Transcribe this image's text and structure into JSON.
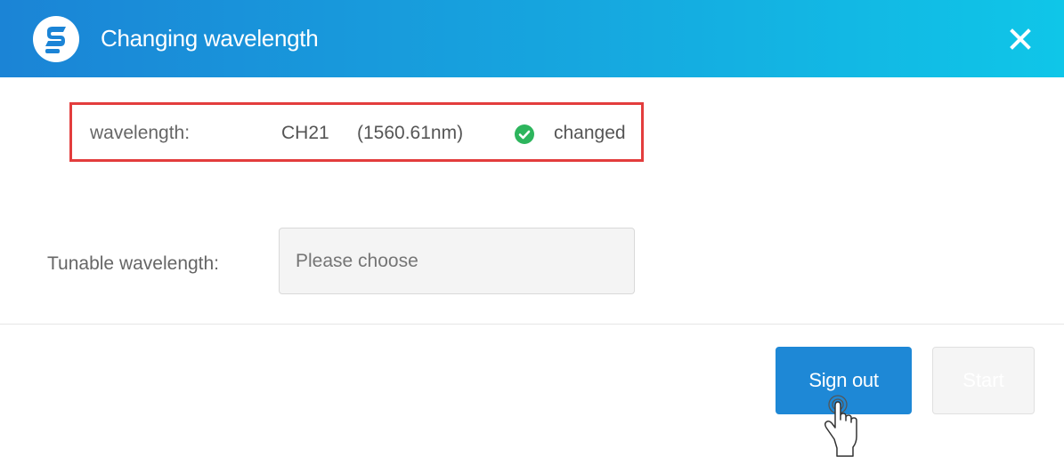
{
  "dialog": {
    "title": "Changing wavelength",
    "logo_icon": "brand-logo-icon",
    "close_icon": "close-icon",
    "header_gradient": [
      "#1b84d6",
      "#0fc6e8"
    ]
  },
  "current": {
    "label": "wavelength:",
    "channel": "CH21",
    "wavelength_nm": "(1560.61nm)",
    "status_icon": "check-circle-icon",
    "status_color": "#2db55d",
    "status_text": "changed",
    "highlight_color": "#e33d3d"
  },
  "tunable": {
    "label": "Tunable wavelength:",
    "placeholder": "Please choose",
    "value": ""
  },
  "footer": {
    "sign_out_label": "Sign out",
    "start_label": "Start",
    "primary_color": "#1e88d6"
  },
  "pointer": {
    "icon": "hand-pointer-icon"
  }
}
